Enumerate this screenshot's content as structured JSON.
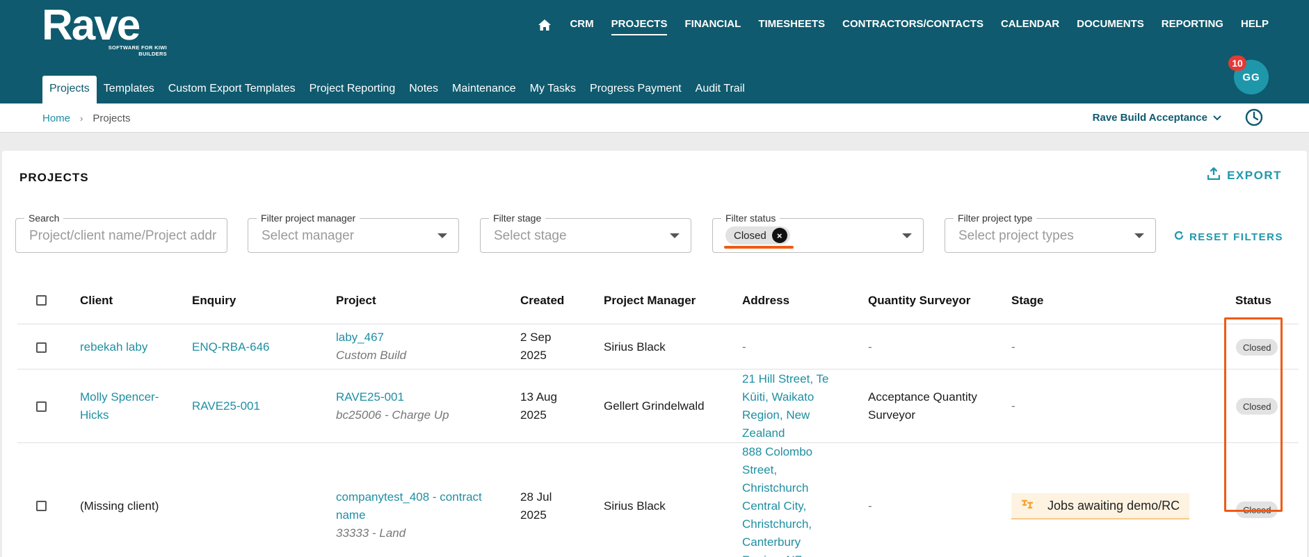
{
  "brand": {
    "name": "Rave",
    "tagline": "SOFTWARE FOR KIWI BUILDERS"
  },
  "colors": {
    "header": "#0f5a6e",
    "accent": "#1f97ab",
    "highlight": "#f05a14",
    "notification": "#e53935"
  },
  "topnav": {
    "home_icon": "home-icon",
    "items": [
      "CRM",
      "PROJECTS",
      "FINANCIAL",
      "TIMESHEETS",
      "CONTRACTORS/CONTACTS",
      "CALENDAR",
      "DOCUMENTS",
      "REPORTING",
      "HELP"
    ],
    "active": "PROJECTS"
  },
  "subnav": {
    "items": [
      "Projects",
      "Templates",
      "Custom Export Templates",
      "Project Reporting",
      "Notes",
      "Maintenance",
      "My Tasks",
      "Progress Payment",
      "Audit Trail"
    ],
    "active": "Projects"
  },
  "user": {
    "initials": "GG",
    "notifications": "10"
  },
  "breadcrumb": {
    "home": "Home",
    "separator": "›",
    "current": "Projects"
  },
  "org_selector": {
    "value": "Rave Build Acceptance"
  },
  "page": {
    "title": "PROJECTS",
    "export_label": "EXPORT",
    "reset_label": "RESET FILTERS"
  },
  "filters": {
    "search": {
      "label": "Search",
      "placeholder": "Project/client name/Project address"
    },
    "manager": {
      "label": "Filter project manager",
      "placeholder": "Select manager"
    },
    "stage": {
      "label": "Filter stage",
      "placeholder": "Select stage"
    },
    "status": {
      "label": "Filter status",
      "chip": "Closed",
      "chip_remove": "×"
    },
    "type": {
      "label": "Filter project type",
      "placeholder": "Select project types"
    }
  },
  "table": {
    "headers": [
      "Client",
      "Enquiry",
      "Project",
      "Created",
      "Project Manager",
      "Address",
      "Quantity Surveyor",
      "Stage",
      "Status"
    ],
    "rows": [
      {
        "client": "rebekah laby",
        "enquiry": "ENQ-RBA-646",
        "project": "laby_467",
        "project_sub": "Custom Build",
        "created_1": "2 Sep",
        "created_2": "2025",
        "manager": "Sirius Black",
        "address": "-",
        "qs": "-",
        "stage": "-",
        "status": "Closed"
      },
      {
        "client_1": "Molly Spencer-",
        "client_2": "Hicks",
        "enquiry": "RAVE25-001",
        "project": "RAVE25-001",
        "project_sub": "bc25006 - Charge Up",
        "created_1": "13 Aug",
        "created_2": "2025",
        "manager": "Gellert Grindelwald",
        "address_lines": [
          "21 Hill Street, Te",
          "Kūiti, Waikato",
          "Region, New",
          "Zealand"
        ],
        "qs_1": "Acceptance Quantity",
        "qs_2": "Surveyor",
        "stage": "-",
        "status": "Closed"
      },
      {
        "client": "(Missing client)",
        "enquiry": "",
        "project_1": "companytest_408 - contract",
        "project_2": "name",
        "project_sub": "33333 - Land",
        "created_1": "28 Jul",
        "created_2": "2025",
        "manager": "Sirius Black",
        "address_lines": [
          "888 Colombo",
          "Street,",
          "Christchurch",
          "Central City,",
          "Christchurch,",
          "Canterbury",
          "Region, NZ"
        ],
        "qs": "-",
        "stage": "Jobs awaiting demo/RC",
        "stage_icon": "demolition-icon",
        "status": "Closed"
      }
    ]
  }
}
